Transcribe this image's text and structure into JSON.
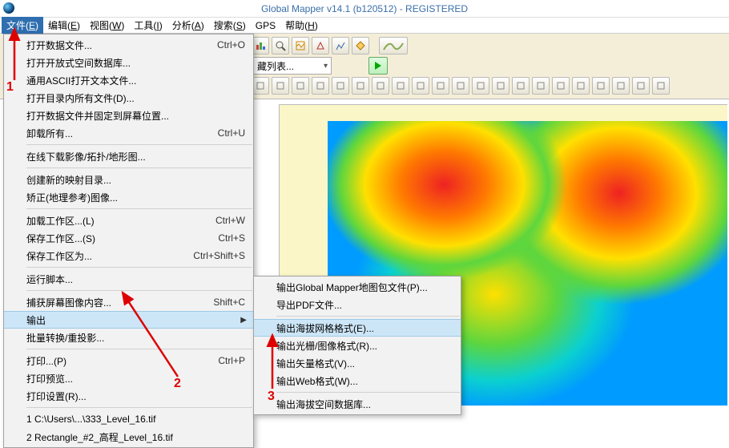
{
  "title": "Global Mapper v14.1 (b120512) - REGISTERED",
  "menubar": [
    {
      "label": "文件",
      "key": "E",
      "active": true
    },
    {
      "label": "编辑",
      "key": "E"
    },
    {
      "label": "视图",
      "key": "W"
    },
    {
      "label": "工具",
      "key": "I"
    },
    {
      "label": "分析",
      "key": "A"
    },
    {
      "label": "搜索",
      "key": "S"
    },
    {
      "label": "GPS",
      "key": ""
    },
    {
      "label": "帮助",
      "key": "H"
    }
  ],
  "combo_label": "藏列表...",
  "file_menu": [
    {
      "label": "打开数据文件...",
      "accel": "Ctrl+O"
    },
    {
      "label": "打开开放式空间数据库..."
    },
    {
      "label": "通用ASCII打开文本文件..."
    },
    {
      "label": "打开目录内所有文件(D)..."
    },
    {
      "label": "打开数据文件并固定到屏幕位置..."
    },
    {
      "label": "卸载所有...",
      "accel": "Ctrl+U"
    },
    {
      "sep": true
    },
    {
      "label": "在线下载影像/拓扑/地形图..."
    },
    {
      "sep": true
    },
    {
      "label": "创建新的映射目录..."
    },
    {
      "label": "矫正(地理参考)图像..."
    },
    {
      "sep": true
    },
    {
      "label": "加载工作区...(L)",
      "accel": "Ctrl+W"
    },
    {
      "label": "保存工作区...(S)",
      "accel": "Ctrl+S"
    },
    {
      "label": "保存工作区为...",
      "accel": "Ctrl+Shift+S"
    },
    {
      "sep": true
    },
    {
      "label": "运行脚本..."
    },
    {
      "sep": true
    },
    {
      "label": "捕获屏幕图像内容...",
      "accel": "Shift+C"
    },
    {
      "label": "输出",
      "submenu": true,
      "hover": true
    },
    {
      "label": "批量转换/重投影..."
    },
    {
      "sep": true
    },
    {
      "label": "打印...(P)",
      "accel": "Ctrl+P"
    },
    {
      "label": "打印预览..."
    },
    {
      "label": "打印设置(R)..."
    },
    {
      "sep": true
    },
    {
      "label": "1 C:\\Users\\...\\333_Level_16.tif"
    },
    {
      "label": "2 Rectangle_#2_高程_Level_16.tif"
    }
  ],
  "submenu": [
    {
      "label": "输出Global Mapper地图包文件(P)..."
    },
    {
      "label": "导出PDF文件..."
    },
    {
      "sep": true
    },
    {
      "label": "输出海拔网格格式(E)...",
      "hover": true
    },
    {
      "label": "输出光栅/图像格式(R)..."
    },
    {
      "label": "输出矢量格式(V)..."
    },
    {
      "label": "输出Web格式(W)..."
    },
    {
      "sep": true
    },
    {
      "label": "输出海拔空间数据库..."
    }
  ],
  "annotations": {
    "n1": "1",
    "n2": "2",
    "n3": "3"
  }
}
